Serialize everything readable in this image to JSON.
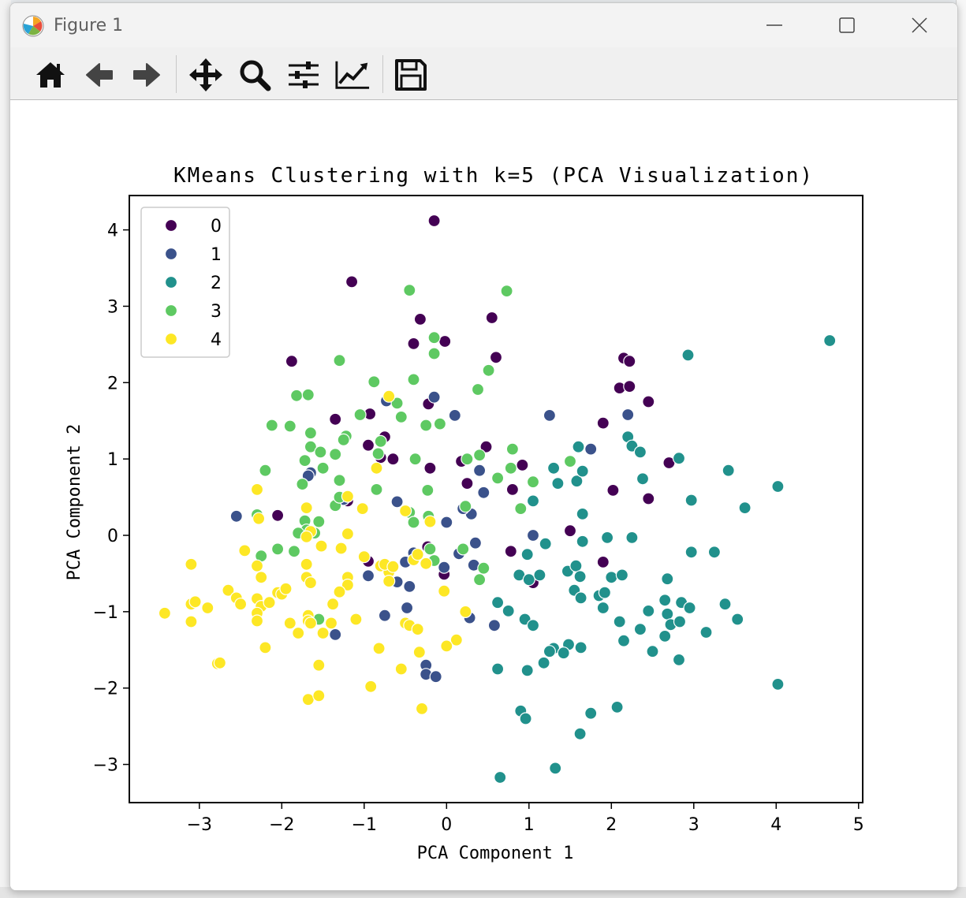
{
  "window": {
    "title": "Figure 1"
  },
  "toolbar": {
    "icons": [
      "home-icon",
      "back-arrow-icon",
      "forward-arrow-icon",
      "pan-icon",
      "zoom-icon",
      "configure-subplots-icon",
      "edit-axis-icon",
      "save-icon"
    ]
  },
  "colors": {
    "c0": "#440154",
    "c1": "#3b528b",
    "c2": "#21918c",
    "c3": "#5ec962",
    "c4": "#fde725"
  },
  "chart_data": {
    "type": "scatter",
    "title": "KMeans Clustering with k=5 (PCA Visualization)",
    "xlabel": "PCA Component 1",
    "ylabel": "PCA Component 2",
    "xlim": [
      -3.85,
      5.05
    ],
    "ylim": [
      -3.5,
      4.45
    ],
    "xticks": [
      "−3",
      "−2",
      "−1",
      "0",
      "1",
      "2",
      "3",
      "4",
      "5"
    ],
    "yticks": [
      "−3",
      "−2",
      "−1",
      "0",
      "1",
      "2",
      "3",
      "4"
    ],
    "xtick_values": [
      -3,
      -2,
      -1,
      0,
      1,
      2,
      3,
      4,
      5
    ],
    "ytick_values": [
      -3,
      -2,
      -1,
      0,
      1,
      2,
      3,
      4
    ],
    "grid": false,
    "legend_position": "top-left",
    "series": [
      {
        "name": "0",
        "color": "#440154",
        "points": [
          [
            -0.15,
            4.12
          ],
          [
            -1.15,
            3.32
          ],
          [
            -0.32,
            2.83
          ],
          [
            -0.4,
            2.51
          ],
          [
            -0.02,
            2.54
          ],
          [
            0.55,
            2.85
          ],
          [
            0.6,
            2.33
          ],
          [
            -1.88,
            2.28
          ],
          [
            2.15,
            2.32
          ],
          [
            2.22,
            2.28
          ],
          [
            2.1,
            1.93
          ],
          [
            2.22,
            1.95
          ],
          [
            2.45,
            1.75
          ],
          [
            1.9,
            1.47
          ],
          [
            -1.35,
            1.52
          ],
          [
            -0.93,
            1.59
          ],
          [
            -0.22,
            1.72
          ],
          [
            0.48,
            1.16
          ],
          [
            -0.75,
            1.29
          ],
          [
            -0.95,
            1.18
          ],
          [
            -0.8,
            1.02
          ],
          [
            -0.65,
            1.0
          ],
          [
            -0.2,
            0.88
          ],
          [
            0.18,
            0.97
          ],
          [
            0.25,
            0.68
          ],
          [
            0.92,
            0.92
          ],
          [
            0.8,
            0.6
          ],
          [
            2.7,
            0.95
          ],
          [
            2.02,
            0.59
          ],
          [
            2.45,
            0.48
          ],
          [
            -1.2,
            0.45
          ],
          [
            -2.05,
            0.26
          ],
          [
            1.5,
            0.06
          ],
          [
            0.78,
            -0.21
          ],
          [
            -0.23,
            -0.15
          ],
          [
            -0.03,
            -0.51
          ],
          [
            -0.95,
            -0.34
          ],
          [
            1.05,
            -0.62
          ],
          [
            1.9,
            -0.35
          ]
        ]
      },
      {
        "name": "1",
        "color": "#3b528b",
        "points": [
          [
            -0.15,
            1.81
          ],
          [
            0.1,
            1.57
          ],
          [
            -0.73,
            1.76
          ],
          [
            1.25,
            1.57
          ],
          [
            2.2,
            1.58
          ],
          [
            1.75,
            1.13
          ],
          [
            0.4,
            0.85
          ],
          [
            0.45,
            0.56
          ],
          [
            0.3,
            0.28
          ],
          [
            0.2,
            0.35
          ],
          [
            -1.65,
            0.82
          ],
          [
            -1.68,
            0.78
          ],
          [
            -2.55,
            0.25
          ],
          [
            -1.25,
            0.47
          ],
          [
            -0.6,
            0.44
          ],
          [
            -0.2,
            0.18
          ],
          [
            0.0,
            0.17
          ],
          [
            1.05,
            0.0
          ],
          [
            0.35,
            -0.1
          ],
          [
            -0.4,
            -0.23
          ],
          [
            -0.5,
            -0.35
          ],
          [
            -0.6,
            -0.61
          ],
          [
            -0.45,
            -0.67
          ],
          [
            -0.03,
            -0.42
          ],
          [
            0.15,
            -0.24
          ],
          [
            0.33,
            -0.39
          ],
          [
            -0.95,
            -0.53
          ],
          [
            -0.75,
            -1.05
          ],
          [
            -0.48,
            -0.95
          ],
          [
            0.28,
            -1.08
          ],
          [
            0.58,
            -1.18
          ],
          [
            -1.35,
            -1.3
          ],
          [
            -0.25,
            -1.7
          ],
          [
            -0.25,
            -1.82
          ],
          [
            -0.13,
            -1.85
          ]
        ]
      },
      {
        "name": "2",
        "color": "#21918c",
        "points": [
          [
            4.65,
            2.55
          ],
          [
            2.93,
            2.36
          ],
          [
            2.2,
            1.29
          ],
          [
            2.25,
            1.17
          ],
          [
            2.35,
            1.09
          ],
          [
            2.82,
            1.01
          ],
          [
            3.42,
            0.85
          ],
          [
            4.02,
            0.64
          ],
          [
            2.38,
            0.74
          ],
          [
            2.97,
            0.46
          ],
          [
            3.62,
            0.36
          ],
          [
            1.6,
            1.16
          ],
          [
            1.58,
            0.71
          ],
          [
            1.65,
            0.84
          ],
          [
            1.3,
            0.88
          ],
          [
            1.35,
            0.68
          ],
          [
            1.05,
            0.45
          ],
          [
            1.65,
            0.28
          ],
          [
            1.2,
            -0.11
          ],
          [
            0.98,
            -0.25
          ],
          [
            1.65,
            -0.08
          ],
          [
            1.95,
            -0.03
          ],
          [
            2.25,
            -0.03
          ],
          [
            2.97,
            -0.22
          ],
          [
            3.25,
            -0.22
          ],
          [
            0.88,
            -0.52
          ],
          [
            1.0,
            -0.58
          ],
          [
            1.13,
            -0.52
          ],
          [
            1.47,
            -0.47
          ],
          [
            1.57,
            -0.4
          ],
          [
            1.62,
            -0.54
          ],
          [
            2.0,
            -0.55
          ],
          [
            2.13,
            -0.52
          ],
          [
            2.68,
            -0.57
          ],
          [
            1.55,
            -0.72
          ],
          [
            1.63,
            -0.82
          ],
          [
            1.85,
            -0.79
          ],
          [
            1.92,
            -0.75
          ],
          [
            2.45,
            -0.99
          ],
          [
            2.65,
            -0.85
          ],
          [
            2.85,
            -0.88
          ],
          [
            2.68,
            -1.03
          ],
          [
            2.95,
            -0.95
          ],
          [
            3.38,
            -0.9
          ],
          [
            3.53,
            -1.1
          ],
          [
            0.62,
            -0.88
          ],
          [
            0.75,
            -0.99
          ],
          [
            0.95,
            -1.1
          ],
          [
            1.05,
            -1.18
          ],
          [
            1.9,
            -0.95
          ],
          [
            2.1,
            -1.13
          ],
          [
            2.35,
            -1.23
          ],
          [
            2.72,
            -1.17
          ],
          [
            2.83,
            -1.13
          ],
          [
            2.65,
            -1.32
          ],
          [
            3.15,
            -1.27
          ],
          [
            2.15,
            -1.38
          ],
          [
            1.3,
            -1.48
          ],
          [
            1.48,
            -1.43
          ],
          [
            1.63,
            -1.47
          ],
          [
            1.42,
            -1.54
          ],
          [
            1.25,
            -1.52
          ],
          [
            2.5,
            -1.52
          ],
          [
            0.62,
            -1.75
          ],
          [
            0.98,
            -1.77
          ],
          [
            1.18,
            -1.67
          ],
          [
            2.82,
            -1.63
          ],
          [
            4.02,
            -1.95
          ],
          [
            0.9,
            -2.3
          ],
          [
            0.96,
            -2.4
          ],
          [
            1.75,
            -2.33
          ],
          [
            2.07,
            -2.25
          ],
          [
            1.62,
            -2.6
          ],
          [
            1.32,
            -3.05
          ],
          [
            0.65,
            -3.17
          ]
        ]
      },
      {
        "name": "3",
        "color": "#5ec962",
        "points": [
          [
            -0.45,
            3.21
          ],
          [
            0.73,
            3.2
          ],
          [
            -0.15,
            2.59
          ],
          [
            -0.15,
            2.38
          ],
          [
            0.51,
            2.16
          ],
          [
            0.38,
            1.91
          ],
          [
            -1.3,
            2.29
          ],
          [
            -0.88,
            2.01
          ],
          [
            -0.4,
            2.04
          ],
          [
            -0.6,
            1.73
          ],
          [
            -1.82,
            1.83
          ],
          [
            -1.68,
            1.84
          ],
          [
            -1.05,
            1.58
          ],
          [
            -0.55,
            1.55
          ],
          [
            -0.25,
            1.44
          ],
          [
            -0.08,
            1.46
          ],
          [
            -2.12,
            1.44
          ],
          [
            -1.9,
            1.43
          ],
          [
            -1.65,
            1.34
          ],
          [
            -1.65,
            1.16
          ],
          [
            -1.53,
            1.09
          ],
          [
            -1.22,
            1.3
          ],
          [
            -1.25,
            1.25
          ],
          [
            -0.8,
            1.23
          ],
          [
            -0.83,
            1.07
          ],
          [
            -0.38,
            1.0
          ],
          [
            -1.72,
            0.98
          ],
          [
            -1.35,
            1.06
          ],
          [
            -2.2,
            0.85
          ],
          [
            -1.5,
            0.88
          ],
          [
            -1.3,
            0.72
          ],
          [
            -1.75,
            0.67
          ],
          [
            -0.85,
            0.6
          ],
          [
            -0.23,
            0.59
          ],
          [
            0.25,
            1.0
          ],
          [
            0.4,
            1.05
          ],
          [
            0.8,
            1.13
          ],
          [
            0.78,
            0.88
          ],
          [
            0.62,
            0.75
          ],
          [
            1.05,
            0.7
          ],
          [
            1.5,
            0.97
          ],
          [
            -1.35,
            0.39
          ],
          [
            -1.3,
            0.5
          ],
          [
            -2.3,
            0.27
          ],
          [
            -1.72,
            0.19
          ],
          [
            -1.7,
            0.07
          ],
          [
            -1.55,
            0.18
          ],
          [
            -1.8,
            0.03
          ],
          [
            -1.6,
            0.03
          ],
          [
            -1.2,
            0.03
          ],
          [
            -0.45,
            0.3
          ],
          [
            -0.4,
            0.17
          ],
          [
            -0.22,
            0.25
          ],
          [
            0.23,
            0.38
          ],
          [
            0.9,
            0.35
          ],
          [
            -2.25,
            -0.27
          ],
          [
            -2.05,
            -0.18
          ],
          [
            -1.85,
            -0.21
          ],
          [
            -0.2,
            -0.18
          ],
          [
            0.2,
            -0.18
          ],
          [
            -0.15,
            -0.33
          ],
          [
            0.45,
            -0.43
          ],
          [
            0.4,
            -0.58
          ],
          [
            -1.55,
            -1.1
          ]
        ]
      },
      {
        "name": "4",
        "color": "#fde725",
        "points": [
          [
            -0.7,
            1.82
          ],
          [
            -0.85,
            0.88
          ],
          [
            -2.3,
            0.6
          ],
          [
            -1.2,
            0.51
          ],
          [
            -1.02,
            0.35
          ],
          [
            -0.5,
            0.32
          ],
          [
            -0.2,
            0.18
          ],
          [
            -1.7,
            0.36
          ],
          [
            -2.28,
            0.22
          ],
          [
            -1.65,
            0.05
          ],
          [
            -1.2,
            0.02
          ],
          [
            -1.7,
            -0.02
          ],
          [
            -1.52,
            -0.14
          ],
          [
            -1.28,
            -0.17
          ],
          [
            -2.45,
            -0.2
          ],
          [
            -2.3,
            -0.4
          ],
          [
            -2.25,
            -0.55
          ],
          [
            -3.1,
            -0.38
          ],
          [
            -1.7,
            -0.38
          ],
          [
            -1.7,
            -0.55
          ],
          [
            -1.65,
            -0.62
          ],
          [
            -1.2,
            -0.55
          ],
          [
            -1.2,
            -0.65
          ],
          [
            -1.3,
            -0.74
          ],
          [
            -1.0,
            -0.28
          ],
          [
            -0.8,
            -0.4
          ],
          [
            -0.7,
            -0.48
          ],
          [
            -0.75,
            -0.38
          ],
          [
            -0.65,
            -0.41
          ],
          [
            -0.25,
            -0.37
          ],
          [
            -0.4,
            -0.32
          ],
          [
            -0.35,
            -0.25
          ],
          [
            -0.7,
            -0.6
          ],
          [
            -2.65,
            -0.72
          ],
          [
            -2.55,
            -0.82
          ],
          [
            -2.5,
            -0.9
          ],
          [
            -2.3,
            -0.83
          ],
          [
            -2.05,
            -0.75
          ],
          [
            -2.0,
            -0.77
          ],
          [
            -1.95,
            -0.7
          ],
          [
            -2.25,
            -0.93
          ],
          [
            -2.15,
            -0.88
          ],
          [
            -3.1,
            -0.9
          ],
          [
            -3.05,
            -0.87
          ],
          [
            -2.9,
            -0.95
          ],
          [
            -2.3,
            -1.02
          ],
          [
            -2.3,
            -1.12
          ],
          [
            -1.9,
            -1.15
          ],
          [
            -1.68,
            -1.05
          ],
          [
            -1.68,
            -1.12
          ],
          [
            -1.65,
            -1.15
          ],
          [
            -1.4,
            -1.15
          ],
          [
            -1.38,
            -0.9
          ],
          [
            -1.5,
            -1.28
          ],
          [
            -1.8,
            -1.28
          ],
          [
            -1.1,
            -1.1
          ],
          [
            -3.42,
            -1.02
          ],
          [
            -3.1,
            -1.13
          ],
          [
            -2.2,
            -1.47
          ],
          [
            -0.82,
            -1.48
          ],
          [
            -0.5,
            -1.15
          ],
          [
            -0.45,
            -1.18
          ],
          [
            -0.35,
            -1.23
          ],
          [
            -0.03,
            -0.73
          ],
          [
            0.23,
            -1.0
          ],
          [
            0.12,
            -1.37
          ],
          [
            0.0,
            -1.45
          ],
          [
            -0.33,
            -1.53
          ],
          [
            -0.55,
            -1.75
          ],
          [
            -1.55,
            -1.7
          ],
          [
            -2.78,
            -1.68
          ],
          [
            -2.75,
            -1.67
          ],
          [
            -0.92,
            -1.98
          ],
          [
            -1.68,
            -2.15
          ],
          [
            -1.55,
            -2.1
          ],
          [
            -0.3,
            -2.27
          ]
        ]
      }
    ]
  }
}
